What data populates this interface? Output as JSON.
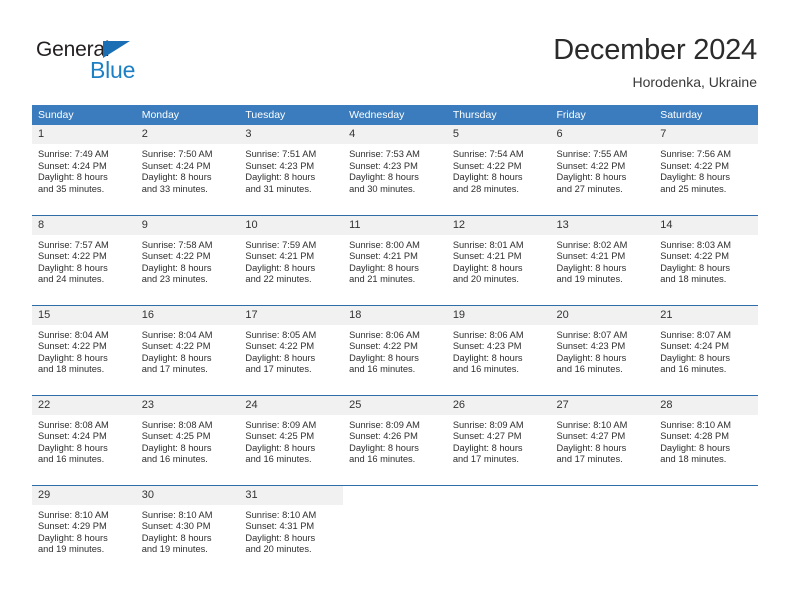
{
  "logo": {
    "word_one": "General",
    "word_two": "Blue",
    "triangle_color": "#1a6fb4",
    "blue_color": "#1d7fc4"
  },
  "header": {
    "month_title": "December 2024",
    "location": "Horodenka, Ukraine"
  },
  "theme": {
    "header_row_bg": "#3a7cbe",
    "daynum_bg": "#f1f1f1",
    "grid_line": "#2f6ca8"
  },
  "weekday_headers": [
    "Sunday",
    "Monday",
    "Tuesday",
    "Wednesday",
    "Thursday",
    "Friday",
    "Saturday"
  ],
  "weeks": [
    [
      {
        "day": "1",
        "sunrise": "Sunrise: 7:49 AM",
        "sunset": "Sunset: 4:24 PM",
        "daylight_1": "Daylight: 8 hours",
        "daylight_2": "and 35 minutes."
      },
      {
        "day": "2",
        "sunrise": "Sunrise: 7:50 AM",
        "sunset": "Sunset: 4:24 PM",
        "daylight_1": "Daylight: 8 hours",
        "daylight_2": "and 33 minutes."
      },
      {
        "day": "3",
        "sunrise": "Sunrise: 7:51 AM",
        "sunset": "Sunset: 4:23 PM",
        "daylight_1": "Daylight: 8 hours",
        "daylight_2": "and 31 minutes."
      },
      {
        "day": "4",
        "sunrise": "Sunrise: 7:53 AM",
        "sunset": "Sunset: 4:23 PM",
        "daylight_1": "Daylight: 8 hours",
        "daylight_2": "and 30 minutes."
      },
      {
        "day": "5",
        "sunrise": "Sunrise: 7:54 AM",
        "sunset": "Sunset: 4:22 PM",
        "daylight_1": "Daylight: 8 hours",
        "daylight_2": "and 28 minutes."
      },
      {
        "day": "6",
        "sunrise": "Sunrise: 7:55 AM",
        "sunset": "Sunset: 4:22 PM",
        "daylight_1": "Daylight: 8 hours",
        "daylight_2": "and 27 minutes."
      },
      {
        "day": "7",
        "sunrise": "Sunrise: 7:56 AM",
        "sunset": "Sunset: 4:22 PM",
        "daylight_1": "Daylight: 8 hours",
        "daylight_2": "and 25 minutes."
      }
    ],
    [
      {
        "day": "8",
        "sunrise": "Sunrise: 7:57 AM",
        "sunset": "Sunset: 4:22 PM",
        "daylight_1": "Daylight: 8 hours",
        "daylight_2": "and 24 minutes."
      },
      {
        "day": "9",
        "sunrise": "Sunrise: 7:58 AM",
        "sunset": "Sunset: 4:22 PM",
        "daylight_1": "Daylight: 8 hours",
        "daylight_2": "and 23 minutes."
      },
      {
        "day": "10",
        "sunrise": "Sunrise: 7:59 AM",
        "sunset": "Sunset: 4:21 PM",
        "daylight_1": "Daylight: 8 hours",
        "daylight_2": "and 22 minutes."
      },
      {
        "day": "11",
        "sunrise": "Sunrise: 8:00 AM",
        "sunset": "Sunset: 4:21 PM",
        "daylight_1": "Daylight: 8 hours",
        "daylight_2": "and 21 minutes."
      },
      {
        "day": "12",
        "sunrise": "Sunrise: 8:01 AM",
        "sunset": "Sunset: 4:21 PM",
        "daylight_1": "Daylight: 8 hours",
        "daylight_2": "and 20 minutes."
      },
      {
        "day": "13",
        "sunrise": "Sunrise: 8:02 AM",
        "sunset": "Sunset: 4:21 PM",
        "daylight_1": "Daylight: 8 hours",
        "daylight_2": "and 19 minutes."
      },
      {
        "day": "14",
        "sunrise": "Sunrise: 8:03 AM",
        "sunset": "Sunset: 4:22 PM",
        "daylight_1": "Daylight: 8 hours",
        "daylight_2": "and 18 minutes."
      }
    ],
    [
      {
        "day": "15",
        "sunrise": "Sunrise: 8:04 AM",
        "sunset": "Sunset: 4:22 PM",
        "daylight_1": "Daylight: 8 hours",
        "daylight_2": "and 18 minutes."
      },
      {
        "day": "16",
        "sunrise": "Sunrise: 8:04 AM",
        "sunset": "Sunset: 4:22 PM",
        "daylight_1": "Daylight: 8 hours",
        "daylight_2": "and 17 minutes."
      },
      {
        "day": "17",
        "sunrise": "Sunrise: 8:05 AM",
        "sunset": "Sunset: 4:22 PM",
        "daylight_1": "Daylight: 8 hours",
        "daylight_2": "and 17 minutes."
      },
      {
        "day": "18",
        "sunrise": "Sunrise: 8:06 AM",
        "sunset": "Sunset: 4:22 PM",
        "daylight_1": "Daylight: 8 hours",
        "daylight_2": "and 16 minutes."
      },
      {
        "day": "19",
        "sunrise": "Sunrise: 8:06 AM",
        "sunset": "Sunset: 4:23 PM",
        "daylight_1": "Daylight: 8 hours",
        "daylight_2": "and 16 minutes."
      },
      {
        "day": "20",
        "sunrise": "Sunrise: 8:07 AM",
        "sunset": "Sunset: 4:23 PM",
        "daylight_1": "Daylight: 8 hours",
        "daylight_2": "and 16 minutes."
      },
      {
        "day": "21",
        "sunrise": "Sunrise: 8:07 AM",
        "sunset": "Sunset: 4:24 PM",
        "daylight_1": "Daylight: 8 hours",
        "daylight_2": "and 16 minutes."
      }
    ],
    [
      {
        "day": "22",
        "sunrise": "Sunrise: 8:08 AM",
        "sunset": "Sunset: 4:24 PM",
        "daylight_1": "Daylight: 8 hours",
        "daylight_2": "and 16 minutes."
      },
      {
        "day": "23",
        "sunrise": "Sunrise: 8:08 AM",
        "sunset": "Sunset: 4:25 PM",
        "daylight_1": "Daylight: 8 hours",
        "daylight_2": "and 16 minutes."
      },
      {
        "day": "24",
        "sunrise": "Sunrise: 8:09 AM",
        "sunset": "Sunset: 4:25 PM",
        "daylight_1": "Daylight: 8 hours",
        "daylight_2": "and 16 minutes."
      },
      {
        "day": "25",
        "sunrise": "Sunrise: 8:09 AM",
        "sunset": "Sunset: 4:26 PM",
        "daylight_1": "Daylight: 8 hours",
        "daylight_2": "and 16 minutes."
      },
      {
        "day": "26",
        "sunrise": "Sunrise: 8:09 AM",
        "sunset": "Sunset: 4:27 PM",
        "daylight_1": "Daylight: 8 hours",
        "daylight_2": "and 17 minutes."
      },
      {
        "day": "27",
        "sunrise": "Sunrise: 8:10 AM",
        "sunset": "Sunset: 4:27 PM",
        "daylight_1": "Daylight: 8 hours",
        "daylight_2": "and 17 minutes."
      },
      {
        "day": "28",
        "sunrise": "Sunrise: 8:10 AM",
        "sunset": "Sunset: 4:28 PM",
        "daylight_1": "Daylight: 8 hours",
        "daylight_2": "and 18 minutes."
      }
    ],
    [
      {
        "day": "29",
        "sunrise": "Sunrise: 8:10 AM",
        "sunset": "Sunset: 4:29 PM",
        "daylight_1": "Daylight: 8 hours",
        "daylight_2": "and 19 minutes."
      },
      {
        "day": "30",
        "sunrise": "Sunrise: 8:10 AM",
        "sunset": "Sunset: 4:30 PM",
        "daylight_1": "Daylight: 8 hours",
        "daylight_2": "and 19 minutes."
      },
      {
        "day": "31",
        "sunrise": "Sunrise: 8:10 AM",
        "sunset": "Sunset: 4:31 PM",
        "daylight_1": "Daylight: 8 hours",
        "daylight_2": "and 20 minutes."
      },
      null,
      null,
      null,
      null
    ]
  ]
}
